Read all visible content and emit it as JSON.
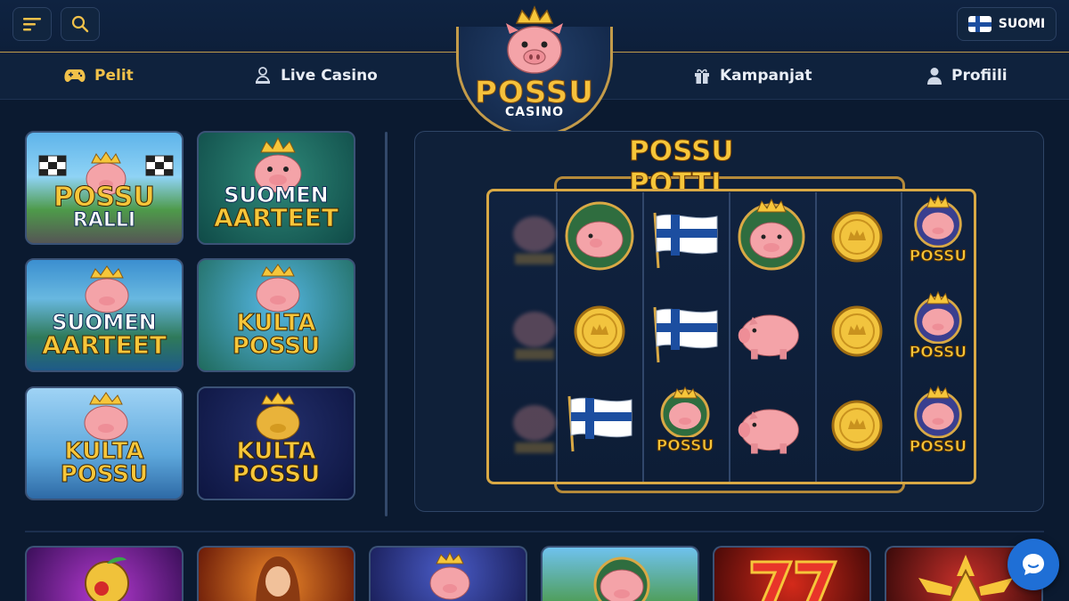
{
  "header": {
    "language_label": "SUOMI",
    "logo_title": "POSSU",
    "logo_subtitle": "CASINO"
  },
  "nav": {
    "items": [
      {
        "label": "Pelit",
        "icon": "gamepad-icon",
        "active": true
      },
      {
        "label": "Live Casino",
        "icon": "live-dealer-icon",
        "active": false
      },
      {
        "label": "Kampanjat",
        "icon": "gift-icon",
        "active": false
      },
      {
        "label": "Profiili",
        "icon": "user-icon",
        "active": false
      }
    ]
  },
  "games": [
    {
      "line1": "POSSU",
      "line2": "RALLI"
    },
    {
      "line1": "SUOMEN",
      "line2": "AARTEET"
    },
    {
      "line1": "SUOMEN",
      "line2": "AARTEET"
    },
    {
      "line1": "KULTA",
      "line2": "POSSU"
    },
    {
      "line1": "KULTA",
      "line2": "POSSU"
    },
    {
      "line1": "KULTA",
      "line2": "POSSU"
    }
  ],
  "slot": {
    "title": "POSSU POTTI",
    "symbol_label": "POSSU"
  },
  "colors": {
    "accent_gold": "#f1c14a",
    "background": "#0b1a30",
    "chat_blue": "#1f6fd6"
  }
}
